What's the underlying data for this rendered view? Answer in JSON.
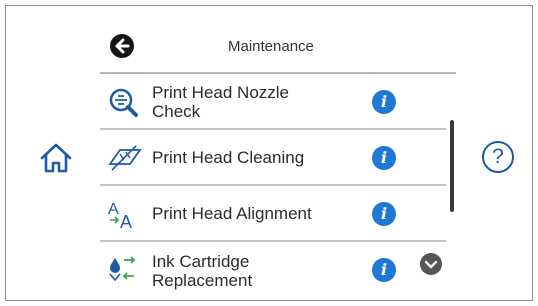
{
  "header": {
    "title": "Maintenance"
  },
  "items": [
    {
      "label_line1": "Print Head Nozzle",
      "label_line2": "Check"
    },
    {
      "label_line1": "Print Head Cleaning"
    },
    {
      "label_line1": "Print Head Alignment"
    },
    {
      "label_line1": "Ink Cartridge",
      "label_line2": "Replacement"
    }
  ],
  "help": {
    "label": "?"
  },
  "info": {
    "glyph": "i"
  },
  "colors": {
    "accent": "#1e78d6",
    "icon_blue": "#1e5aa8"
  }
}
